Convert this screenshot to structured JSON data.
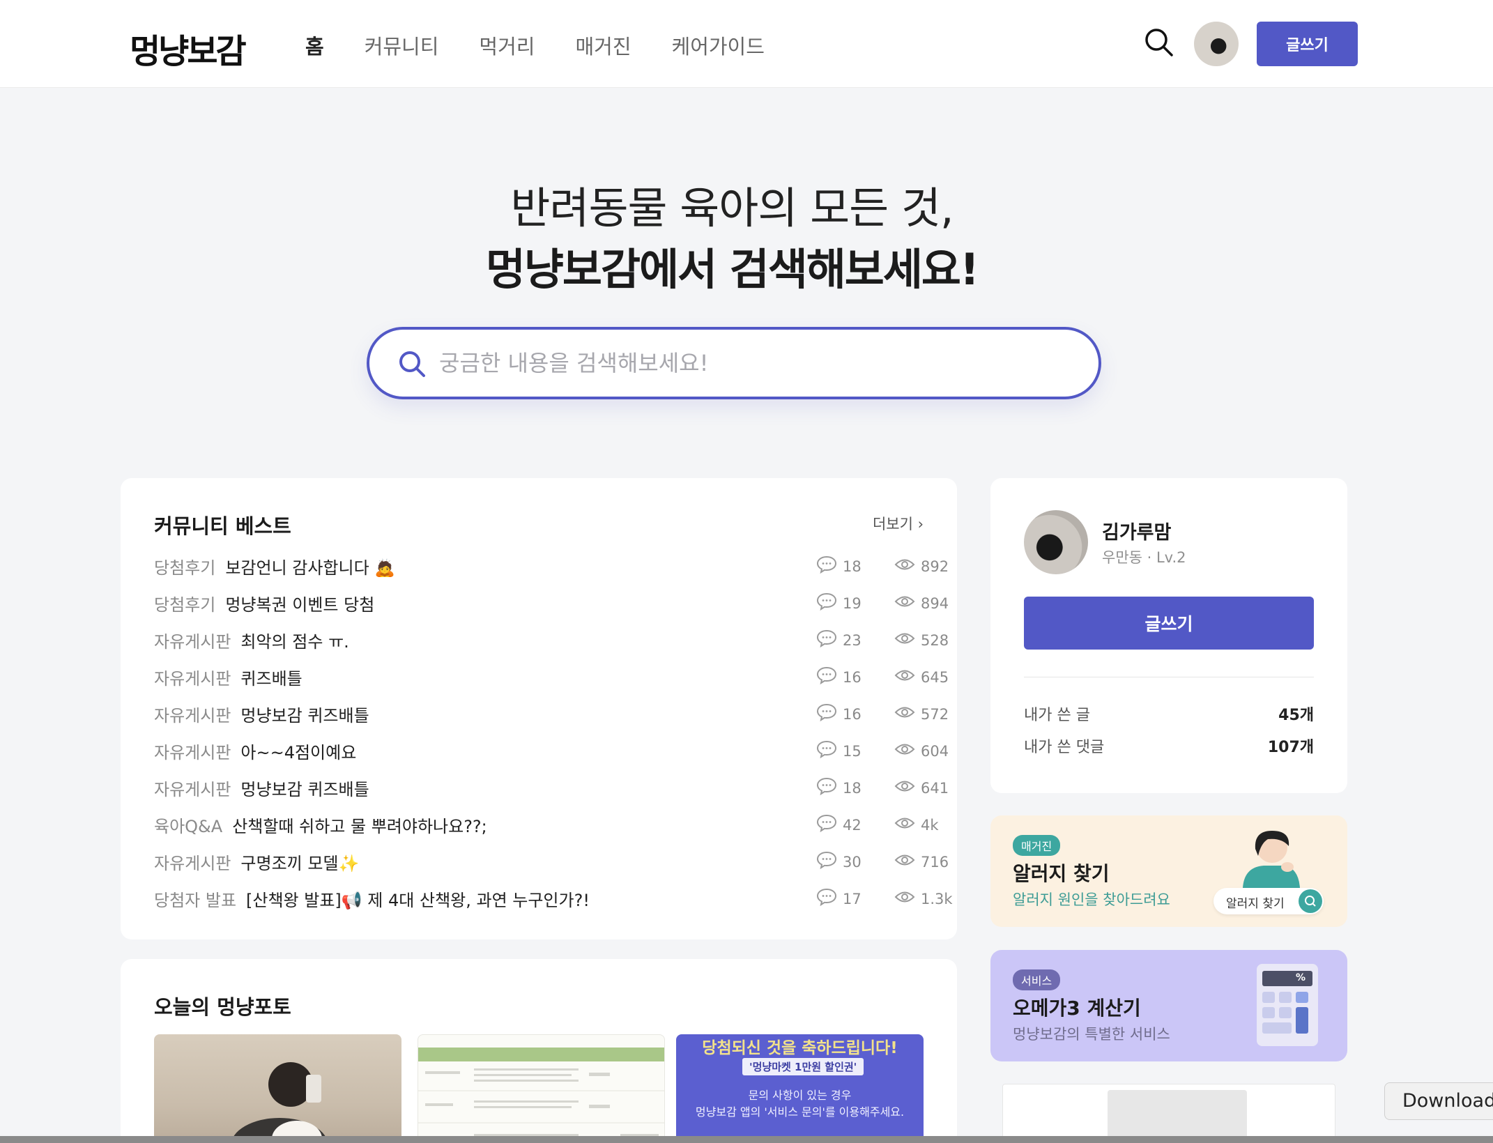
{
  "header": {
    "logo": "멍냥보감",
    "nav": [
      "홈",
      "커뮤니티",
      "먹거리",
      "매거진",
      "케어가이드"
    ],
    "write_label": "글쓰기"
  },
  "hero": {
    "line1": "반려동물 육아의 모든 것,",
    "line2": "멍냥보감에서 검색해보세요!",
    "search_placeholder": "궁금한 내용을 검색해보세요!"
  },
  "best": {
    "title": "커뮤니티 베스트",
    "more": "더보기 ›",
    "items": [
      {
        "category": "당첨후기",
        "title": "보감언니 감사합니다 🙇",
        "comments": "18",
        "views": "892"
      },
      {
        "category": "당첨후기",
        "title": "멍냥복권 이벤트 당첨",
        "comments": "19",
        "views": "894"
      },
      {
        "category": "자유게시판",
        "title": "최악의 점수 ㅠ.",
        "comments": "23",
        "views": "528"
      },
      {
        "category": "자유게시판",
        "title": "퀴즈배틀",
        "comments": "16",
        "views": "645"
      },
      {
        "category": "자유게시판",
        "title": "멍냥보감 퀴즈배틀",
        "comments": "16",
        "views": "572"
      },
      {
        "category": "자유게시판",
        "title": "아~~4점이예요",
        "comments": "15",
        "views": "604"
      },
      {
        "category": "자유게시판",
        "title": "멍냥보감 퀴즈배틀",
        "comments": "18",
        "views": "641"
      },
      {
        "category": "육아Q&A",
        "title": "산책할때 쉬하고 물 뿌려야하나요??;",
        "comments": "42",
        "views": "4k"
      },
      {
        "category": "자유게시판",
        "title": "구명조끼 모델✨",
        "comments": "30",
        "views": "716"
      },
      {
        "category": "당첨자 발표",
        "title": "[산책왕 발표]📢 제 4대 산책왕, 과연 누구인가?!",
        "comments": "17",
        "views": "1.3k"
      }
    ]
  },
  "photos": {
    "title": "오늘의 멍냥포토",
    "photo3_heading": "당첨되신 것을 축하드립니다!",
    "photo3_tag": "'멍냥마켓 1만원 할인권'",
    "photo3_text1": "문의 사항이 있는 경우",
    "photo3_text2": "멍냥보감 앱의 '서비스 문의'를 이용해주세요."
  },
  "profile": {
    "name": "김가루맘",
    "sub": "우만동 · Lv.2",
    "write_label": "글쓰기",
    "stats": [
      {
        "label": "내가 쓴 글",
        "value": "45개"
      },
      {
        "label": "내가 쓴 댓글",
        "value": "107개"
      }
    ]
  },
  "promos": {
    "allergy": {
      "tag": "매거진",
      "title": "알러지 찾기",
      "desc": "알러지 원인을 찾아드려요",
      "button": "알러지 찾기"
    },
    "omega": {
      "tag": "서비스",
      "title": "오메가3 계산기",
      "desc": "멍냥보감의 특별한 서비스",
      "calc_display": "%"
    }
  },
  "download_tooltip": "Download",
  "colors": {
    "accent": "#5258c6",
    "teal": "#3da7a0",
    "allergy_bg": "#fcf1e1",
    "omega_bg": "#cbc6f7"
  }
}
